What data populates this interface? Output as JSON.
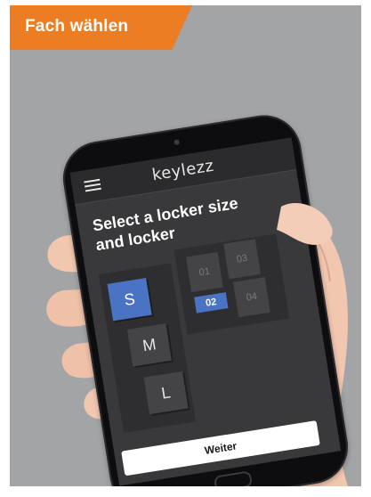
{
  "banner": {
    "title": "Fach wählen"
  },
  "app": {
    "logo": "keylezz"
  },
  "screen": {
    "title_line1": "Select a locker size",
    "title_line2": "and locker",
    "sizes": [
      {
        "label": "S",
        "selected": true
      },
      {
        "label": "M",
        "selected": false
      },
      {
        "label": "L",
        "selected": false
      }
    ],
    "lockers": [
      {
        "label": "01",
        "selected": false
      },
      {
        "label": "02",
        "selected": true
      },
      {
        "label": "03",
        "selected": false
      },
      {
        "label": "04",
        "selected": false
      }
    ],
    "next_label": "Weiter"
  },
  "colors": {
    "banner": "#ec7d23",
    "accent": "#4a73c4",
    "background": "#a3a4a6"
  }
}
